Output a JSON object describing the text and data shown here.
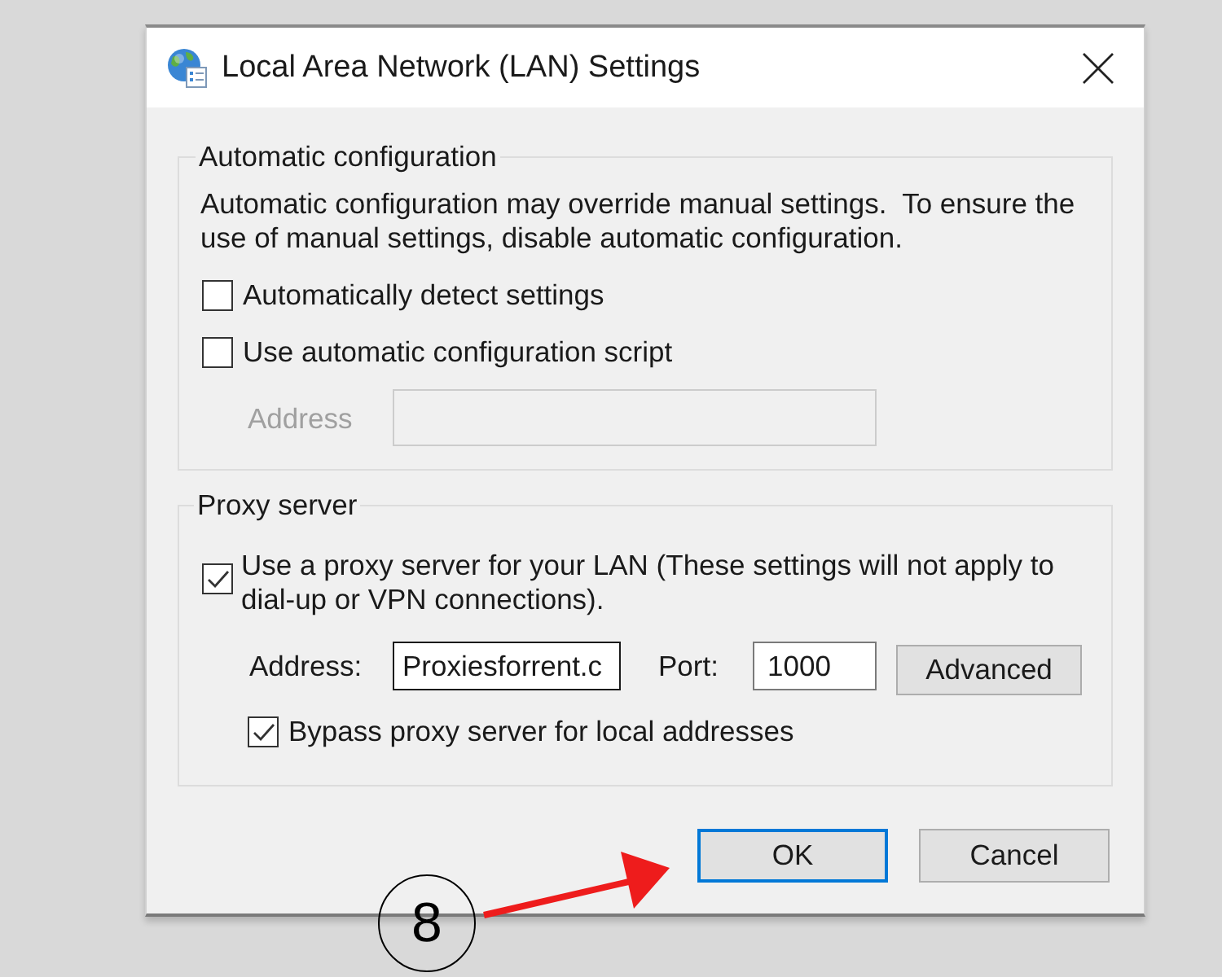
{
  "window": {
    "title": "Local Area Network (LAN) Settings"
  },
  "automatic_configuration": {
    "title": "Automatic configuration",
    "description": "Automatic configuration may override manual settings.  To ensure the use of manual settings, disable automatic configuration.",
    "options": [
      {
        "label": "Automatically detect settings",
        "checked": false
      },
      {
        "label": "Use automatic configuration script",
        "checked": false
      }
    ],
    "address": {
      "label": "Address",
      "disabled": true
    }
  },
  "proxy_server": {
    "title": "Proxy server",
    "use_proxy": {
      "label": "Use a proxy server for your LAN (These settings will not apply to dial-up or VPN connections).",
      "checked": true
    },
    "address": {
      "label": "Address:",
      "value": "Proxiesforrent.c"
    },
    "port": {
      "label": "Port:",
      "value": "1000"
    },
    "advanced_button": "Advanced",
    "bypass_local": {
      "label": "Bypass proxy server for local addresses",
      "checked": true
    }
  },
  "buttons": [
    {
      "label": "OK",
      "default": true
    },
    {
      "label": "Cancel",
      "default": false
    }
  ],
  "callout": {
    "number": "8"
  }
}
